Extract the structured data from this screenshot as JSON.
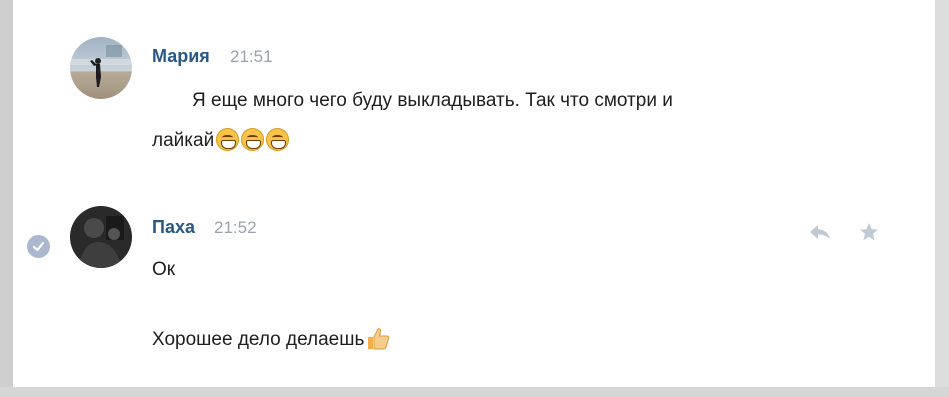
{
  "messages": [
    {
      "author": "Мария",
      "time": "21:51",
      "lines": [
        "Я еще много чего буду выкладывать. Так что смотри и",
        "лайкай"
      ],
      "emoji": [
        "grinning-face",
        "grinning-face",
        "grinning-face"
      ],
      "avatar_icon": "avatar-photo-beach"
    },
    {
      "author": "Паха",
      "time": "21:52",
      "lines": [
        "Ок",
        "Хорошее дело делаешь"
      ],
      "emoji": [
        "thumbs-up"
      ],
      "avatar_icon": "avatar-photo-dark",
      "selected": true
    }
  ],
  "actions": {
    "reply_icon": "reply-icon",
    "star_icon": "star-icon"
  },
  "colors": {
    "author": "#2a5885",
    "time": "#9aa3ad",
    "text": "#1e1e1e",
    "check": "#a9b8cc",
    "action_icon": "#c1c9d3"
  }
}
